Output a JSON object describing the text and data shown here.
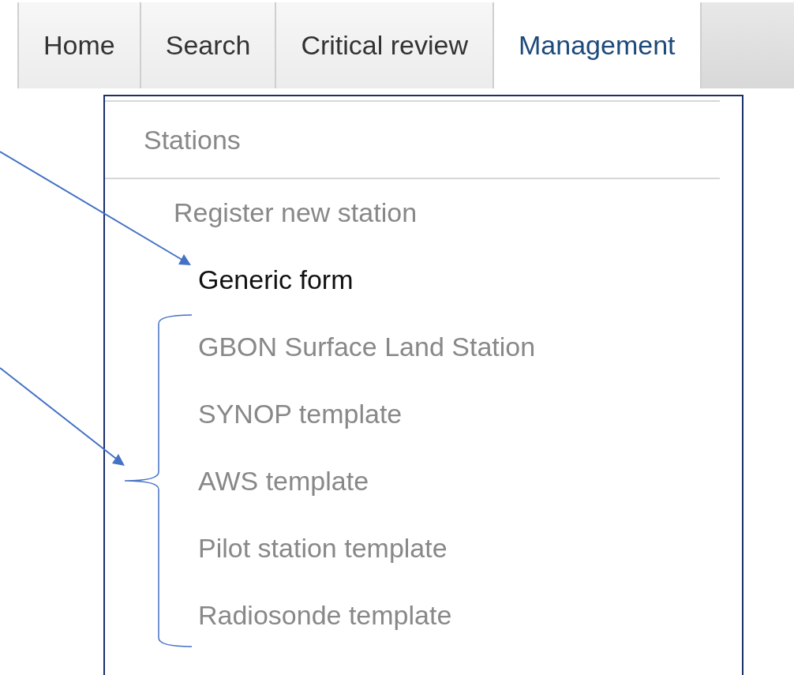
{
  "tabs": [
    {
      "label": "Home",
      "selected": false
    },
    {
      "label": "Search",
      "selected": false
    },
    {
      "label": "Critical review",
      "selected": false
    },
    {
      "label": "Management",
      "selected": true
    }
  ],
  "menu": {
    "heading": "Stations",
    "item": "Register new station",
    "sub_items": [
      {
        "label": "Generic form",
        "selected": true
      },
      {
        "label": "GBON Surface Land Station",
        "selected": false
      },
      {
        "label": "SYNOP template",
        "selected": false
      },
      {
        "label": "AWS template",
        "selected": false
      },
      {
        "label": "Pilot station template",
        "selected": false
      },
      {
        "label": "Radiosonde template",
        "selected": false
      }
    ]
  }
}
